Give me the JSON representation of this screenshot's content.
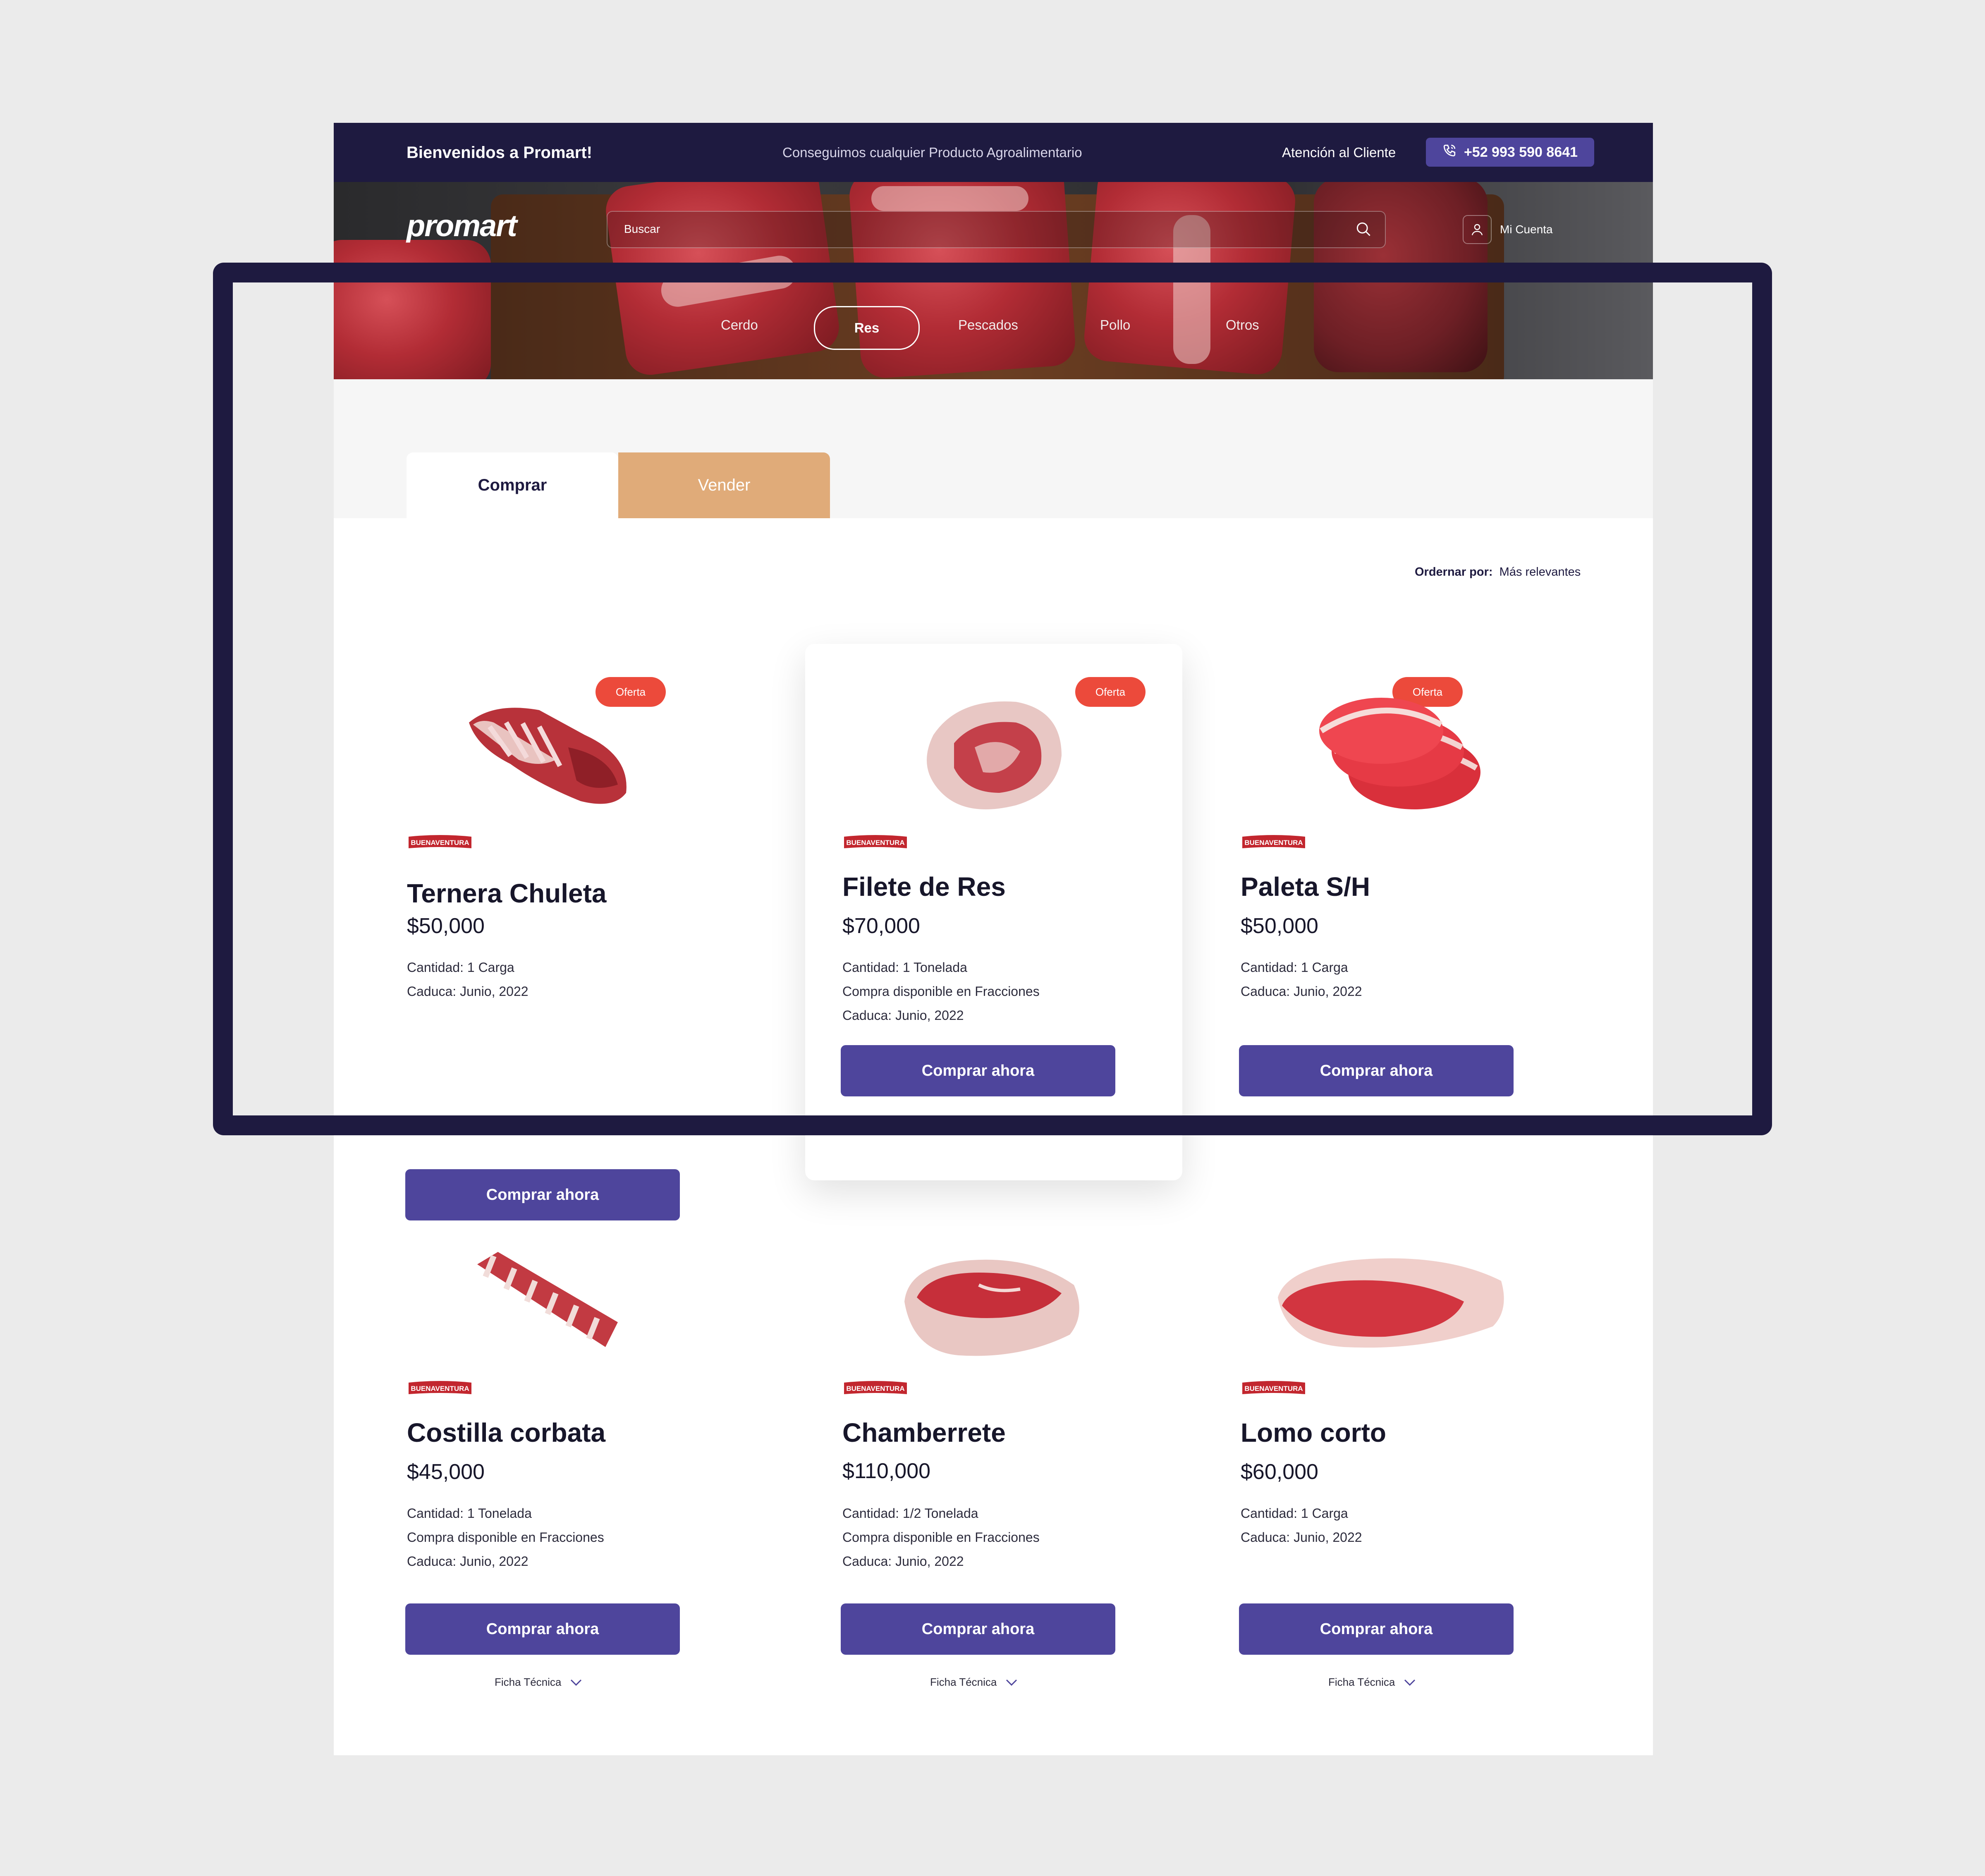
{
  "topbar": {
    "welcome": "Bienvenidos a Promart!",
    "tagline": "Conseguimos cualquier Producto Agroalimentario",
    "support_label": "Atención al Cliente",
    "phone": "+52 993 590 8641"
  },
  "header": {
    "logo": "promart",
    "search_placeholder": "Buscar",
    "account_label": "Mi Cuenta"
  },
  "categories": [
    {
      "label": "Cerdo",
      "active": false
    },
    {
      "label": "Res",
      "active": true
    },
    {
      "label": "Pescados",
      "active": false
    },
    {
      "label": "Pollo",
      "active": false
    },
    {
      "label": "Otros",
      "active": false
    }
  ],
  "tabs": [
    {
      "label": "Comprar",
      "active": true
    },
    {
      "label": "Vender",
      "active": false
    }
  ],
  "sort": {
    "label": "Ordernar por:",
    "value": "Más relevantes"
  },
  "brand": "BUENAVENTURA",
  "products": [
    {
      "name": "Ternera Chuleta",
      "price": "$50,000",
      "badge": "Oferta",
      "lines": [
        "Cantidad: 1 Carga",
        "Caduca: Junio, 2022"
      ],
      "button": "Comprar ahora"
    },
    {
      "name": "Filete de Res",
      "price": "$70,000",
      "badge": "Oferta",
      "lines": [
        "Cantidad: 1 Tonelada",
        "Compra disponible en Fracciones",
        "Caduca: Junio, 2022"
      ],
      "button": "Comprar ahora"
    },
    {
      "name": "Paleta S/H",
      "price": "$50,000",
      "badge": "Oferta",
      "lines": [
        "Cantidad: 1 Carga",
        "Caduca: Junio, 2022"
      ],
      "button": "Comprar ahora"
    },
    {
      "name": "Costilla corbata",
      "price": "$45,000",
      "lines": [
        "Cantidad: 1 Tonelada",
        "Compra disponible en Fracciones",
        "Caduca: Junio, 2022"
      ],
      "button": "Comprar ahora",
      "ficha": "Ficha Técnica"
    },
    {
      "name": "Chamberrete",
      "price": "$110,000",
      "lines": [
        "Cantidad: 1/2 Tonelada",
        "Compra disponible en Fracciones",
        "Caduca: Junio, 2022"
      ],
      "button": "Comprar ahora",
      "ficha": "Ficha Técnica"
    },
    {
      "name": "Lomo corto",
      "price": "$60,000",
      "lines": [
        "Cantidad: 1 Carga",
        "Caduca: Junio, 2022"
      ],
      "button": "Comprar ahora",
      "ficha": "Ficha Técnica"
    }
  ],
  "colors": {
    "navy": "#1e1a40",
    "primary": "#4e459c",
    "offer": "#ec4a3b",
    "sell_tab": "#e0ab79"
  }
}
